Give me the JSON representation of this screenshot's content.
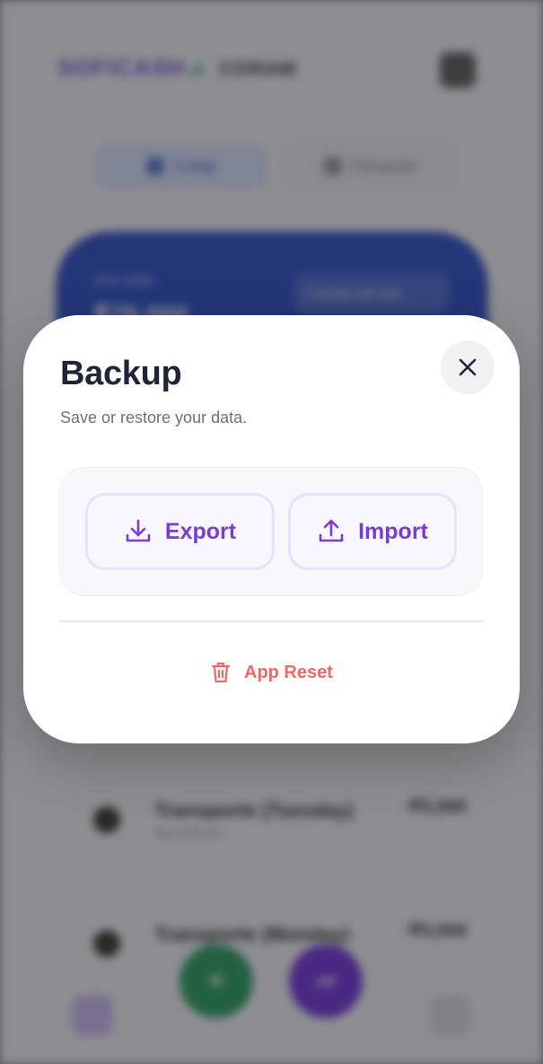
{
  "background": {
    "logo": {
      "part1": "SOFICASH",
      "part2": "⇄",
      "part3": "CORAM"
    },
    "tabs": [
      {
        "label": "Cohgi"
      },
      {
        "label": "Personal"
      }
    ],
    "card": {
      "label": "Oria saldo",
      "amount": "₹75.000",
      "chip": "Cuentas este mes"
    },
    "rows": [
      {
        "title": "Transporte (Tuesday)",
        "sub": "Hoy 9:00 am",
        "value": "-₹5,000"
      },
      {
        "title": "Transporte (Monday)",
        "sub": "",
        "value": "-₹5,000"
      }
    ],
    "fab_add": "+",
    "fab_other": "AB"
  },
  "modal": {
    "title": "Backup",
    "subtitle": "Save or restore your data.",
    "export_label": "Export",
    "import_label": "Import",
    "reset_label": "App Reset"
  },
  "colors": {
    "accent_purple": "#7a3bd6",
    "danger_red": "#ee6868",
    "title_dark": "#1e2636"
  },
  "icons": {
    "close": "close-icon",
    "export": "download-icon",
    "import": "upload-icon",
    "reset": "trash-icon"
  }
}
